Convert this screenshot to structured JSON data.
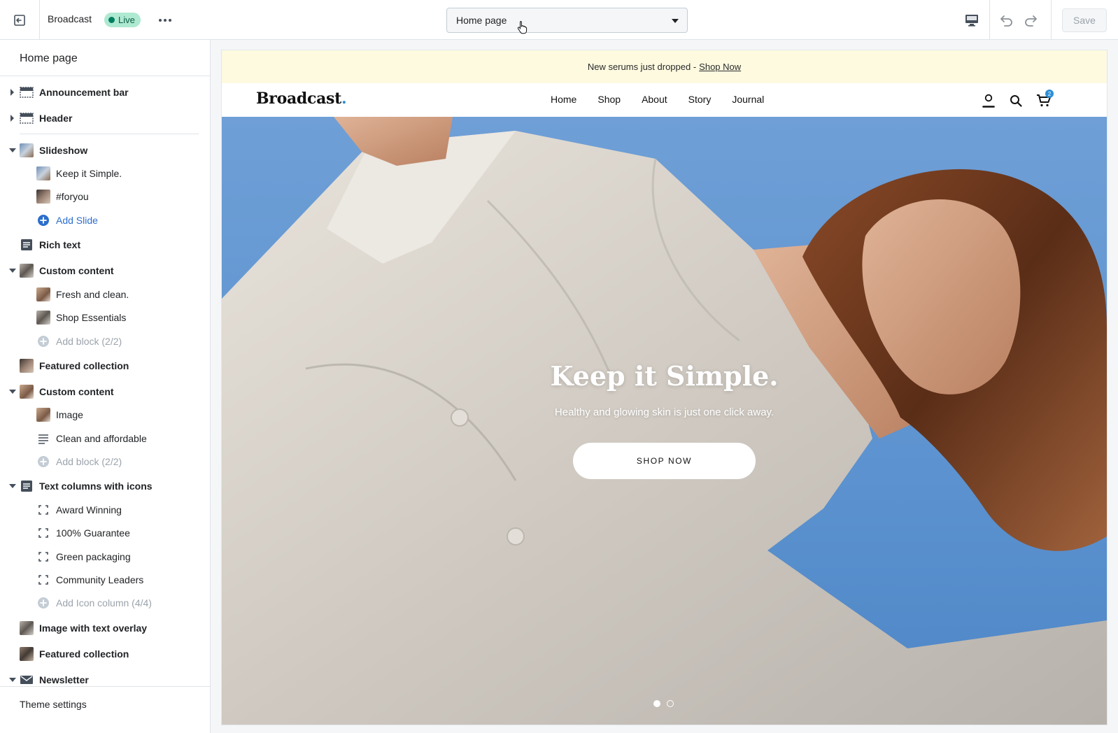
{
  "topbar": {
    "theme_name": "Broadcast",
    "status_badge": "Live",
    "page_select": "Home page",
    "save_label": "Save"
  },
  "sidebar": {
    "title": "Home page",
    "items": [
      {
        "label": "Announcement bar"
      },
      {
        "label": "Header"
      },
      {
        "label": "Slideshow"
      },
      {
        "label": "Keep it Simple."
      },
      {
        "label": "#foryou"
      },
      {
        "label": "Add Slide"
      },
      {
        "label": "Rich text"
      },
      {
        "label": "Custom content"
      },
      {
        "label": "Fresh and clean."
      },
      {
        "label": "Shop Essentials"
      },
      {
        "label": "Add block (2/2)"
      },
      {
        "label": "Featured collection"
      },
      {
        "label": "Custom content"
      },
      {
        "label": "Image"
      },
      {
        "label": "Clean and affordable"
      },
      {
        "label": "Add block (2/2)"
      },
      {
        "label": "Text columns with icons"
      },
      {
        "label": "Award Winning"
      },
      {
        "label": "100% Guarantee"
      },
      {
        "label": "Green packaging"
      },
      {
        "label": "Community Leaders"
      },
      {
        "label": "Add Icon column (4/4)"
      },
      {
        "label": "Image with text overlay"
      },
      {
        "label": "Featured collection"
      },
      {
        "label": "Newsletter"
      }
    ],
    "footer": "Theme settings"
  },
  "preview": {
    "announcement_text": "New serums just dropped -",
    "announcement_link": "Shop Now",
    "logo": "Broadcast",
    "logo_dot": ".",
    "nav": [
      "Home",
      "Shop",
      "About",
      "Story",
      "Journal"
    ],
    "cart_count": "2",
    "hero_title": "Keep it Simple.",
    "hero_subtitle": "Healthy and glowing skin is just one click away.",
    "hero_button": "SHOP NOW",
    "slide_count": 2,
    "active_slide": 1
  },
  "colors": {
    "live_badge": "#aee9d1",
    "add_link": "#2c6ecb",
    "announcement_bg": "#fdfae0",
    "sky": "#5d93d0",
    "logo_accent": "#2d8fd6"
  },
  "icons": [
    "exit-icon",
    "more-icon",
    "chevron-down-icon",
    "cursor-hand-icon",
    "desktop-icon",
    "undo-icon",
    "redo-icon",
    "account-icon",
    "search-icon",
    "cart-icon"
  ]
}
